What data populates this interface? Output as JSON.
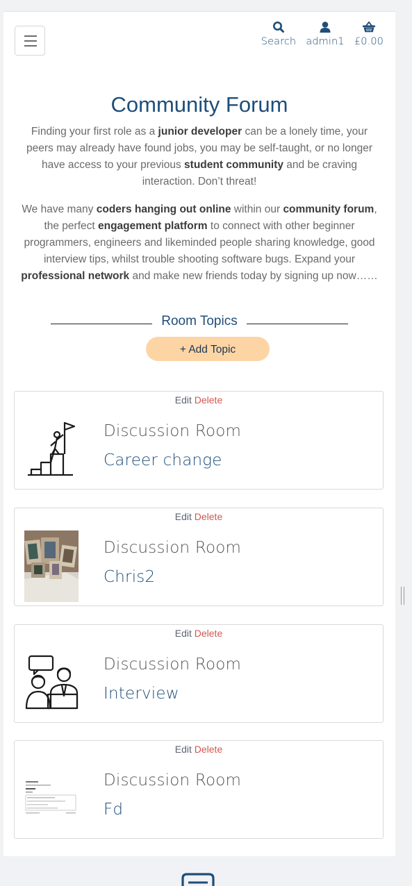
{
  "header": {
    "menu_icon": "hamburger-icon",
    "nav": [
      {
        "icon": "search-icon",
        "label": "Search"
      },
      {
        "icon": "user-icon",
        "label": "admin1"
      },
      {
        "icon": "basket-icon",
        "label": "£0.00"
      }
    ]
  },
  "intro": {
    "title": "Community Forum",
    "p1": [
      "Finding your first role as a ",
      "junior developer",
      " can be a lonely time, your peers may already have found jobs, you may be self-taught, or no longer have access to your previous ",
      "student community",
      " and be craving interaction. Don’t threat!"
    ],
    "p2": [
      "We have many ",
      "coders hanging out online",
      " within our ",
      "community forum",
      ", the perfect ",
      "engagement platform",
      " to connect with other beginner programmers, engineers and likeminded people sharing knowledge, good interview tips, whilst trouble shooting software bugs. Expand your ",
      "professional network",
      " and make new friends today by signing up now……"
    ]
  },
  "topics": {
    "heading": "Room Topics",
    "add_button": "+ Add Topic"
  },
  "rooms": [
    {
      "edit": "Edit",
      "delete": "Delete",
      "label": "Discussion Room",
      "name": "Career change",
      "thumb": "career-climb-icon"
    },
    {
      "edit": "Edit",
      "delete": "Delete",
      "label": "Discussion Room",
      "name": "Chris2",
      "thumb": "photo-frames-image"
    },
    {
      "edit": "Edit",
      "delete": "Delete",
      "label": "Discussion Room",
      "name": "Interview",
      "thumb": "interview-people-icon"
    },
    {
      "edit": "Edit",
      "delete": "Delete",
      "label": "Discussion Room",
      "name": "Fd",
      "thumb": "document-screenshot-image"
    }
  ],
  "colors": {
    "brand": "#1f4e79",
    "button_bg": "#fdd5a5",
    "delete": "#d0574f"
  }
}
